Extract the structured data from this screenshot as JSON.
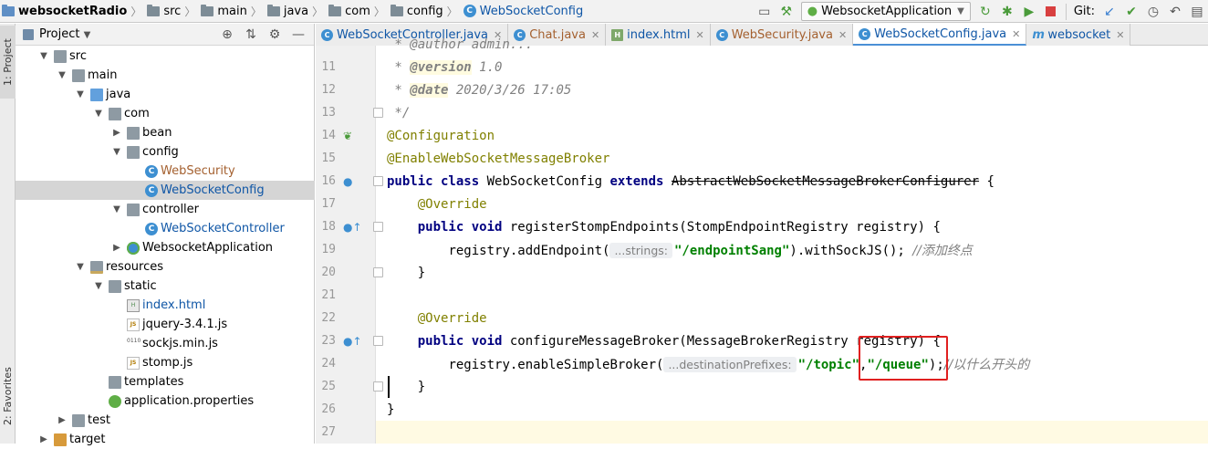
{
  "breadcrumb": [
    {
      "label": "websocketRadio",
      "icon": "module-folder-icon"
    },
    {
      "label": "src",
      "icon": "folder-icon"
    },
    {
      "label": "main",
      "icon": "folder-icon"
    },
    {
      "label": "java",
      "icon": "folder-icon"
    },
    {
      "label": "com",
      "icon": "folder-icon"
    },
    {
      "label": "config",
      "icon": "folder-icon"
    },
    {
      "label": "WebSocketConfig",
      "icon": "class-icon"
    }
  ],
  "toolbar": {
    "run_config": "WebsocketApplication",
    "git_label": "Git:"
  },
  "sidebar": {
    "project_tab": "1: Project",
    "favorites_tab": "2: Favorites"
  },
  "project_panel": {
    "title": "Project",
    "tree": [
      {
        "label": "src",
        "depth": 1,
        "icon": "folder",
        "expanded": true
      },
      {
        "label": "main",
        "depth": 2,
        "icon": "folder",
        "expanded": true
      },
      {
        "label": "java",
        "depth": 3,
        "icon": "source-folder",
        "expanded": true
      },
      {
        "label": "com",
        "depth": 4,
        "icon": "folder",
        "expanded": true
      },
      {
        "label": "bean",
        "depth": 5,
        "icon": "folder",
        "expanded": false
      },
      {
        "label": "config",
        "depth": 5,
        "icon": "folder",
        "expanded": true
      },
      {
        "label": "WebSecurity",
        "depth": 6,
        "icon": "class",
        "color": "#a4602f"
      },
      {
        "label": "WebSocketConfig",
        "depth": 6,
        "icon": "class",
        "color": "#0f56a6",
        "selected": true
      },
      {
        "label": "controller",
        "depth": 5,
        "icon": "folder",
        "expanded": true
      },
      {
        "label": "WebSocketController",
        "depth": 6,
        "icon": "class",
        "color": "#0f56a6"
      },
      {
        "label": "WebsocketApplication",
        "depth": 5,
        "icon": "app-class",
        "expanded": false
      },
      {
        "label": "resources",
        "depth": 3,
        "icon": "resource-folder",
        "expanded": true
      },
      {
        "label": "static",
        "depth": 4,
        "icon": "folder",
        "expanded": true
      },
      {
        "label": "index.html",
        "depth": 5,
        "icon": "html",
        "color": "#0f56a6"
      },
      {
        "label": "jquery-3.4.1.js",
        "depth": 5,
        "icon": "js"
      },
      {
        "label": "sockjs.min.js",
        "depth": 5,
        "icon": "minjs"
      },
      {
        "label": "stomp.js",
        "depth": 5,
        "icon": "js"
      },
      {
        "label": "templates",
        "depth": 4,
        "icon": "folder"
      },
      {
        "label": "application.properties",
        "depth": 4,
        "icon": "properties"
      },
      {
        "label": "test",
        "depth": 2,
        "icon": "folder",
        "expanded": false
      },
      {
        "label": "target",
        "depth": 1,
        "icon": "target-folder",
        "expanded": false
      }
    ]
  },
  "tabs": [
    {
      "label": "WebSocketController.java",
      "color": "#0f56a6",
      "icon": "class"
    },
    {
      "label": "Chat.java",
      "color": "#a4602f",
      "icon": "class"
    },
    {
      "label": "index.html",
      "color": "#0f56a6",
      "icon": "html"
    },
    {
      "label": "WebSecurity.java",
      "color": "#a4602f",
      "icon": "class"
    },
    {
      "label": "WebSocketConfig.java",
      "color": "#0f56a6",
      "icon": "class",
      "active": true
    },
    {
      "label": "websocket",
      "color": "#0f56a6",
      "icon": "m"
    }
  ],
  "code": {
    "line_numbers": [
      "11",
      "12",
      "13",
      "14",
      "15",
      "16",
      "17",
      "18",
      "19",
      "20",
      "21",
      "22",
      "23",
      "24",
      "25",
      "26",
      "27"
    ],
    "l10": " * @author admin...",
    "l11_prefix": " * ",
    "l11_tag": "@version",
    "l11_rest": " 1.0",
    "l12_prefix": " * ",
    "l12_tag": "@date",
    "l12_rest": " 2020/3/26 17:05",
    "l13": " */",
    "l14": "@Configuration",
    "l15": "@EnableWebSocketMessageBroker",
    "l16_kw1": "public class",
    "l16_name": " WebSocketConfig ",
    "l16_kw2": "extends",
    "l16_parent": "AbstractWebSocketMessageBrokerConfigurer",
    "l16_end": " {",
    "l17": "@Override",
    "l18_kw": "public void",
    "l18_rest": " registerStompEndpoints(StompEndpointRegistry registry) {",
    "l19_pre": "registry.addEndpoint(",
    "l19_hint": "...strings:",
    "l19_str": "\"/endpointSang\"",
    "l19_post": ").withSockJS(); ",
    "l19_comment": "//添加终点",
    "l20": "}",
    "l22": "@Override",
    "l23_kw": "public void",
    "l23_rest": " configureMessageBroker(MessageBrokerRegistry registry) {",
    "l24_pre": "registry.enableSimpleBroker(",
    "l24_hint": "...destinationPrefixes:",
    "l24_str1": "\"/topic\"",
    "l24_comma": ",",
    "l24_str2": "\"/queue\"",
    "l24_post": ");",
    "l24_comment": "//以什么开头的",
    "l25": "}",
    "l26": "}"
  }
}
